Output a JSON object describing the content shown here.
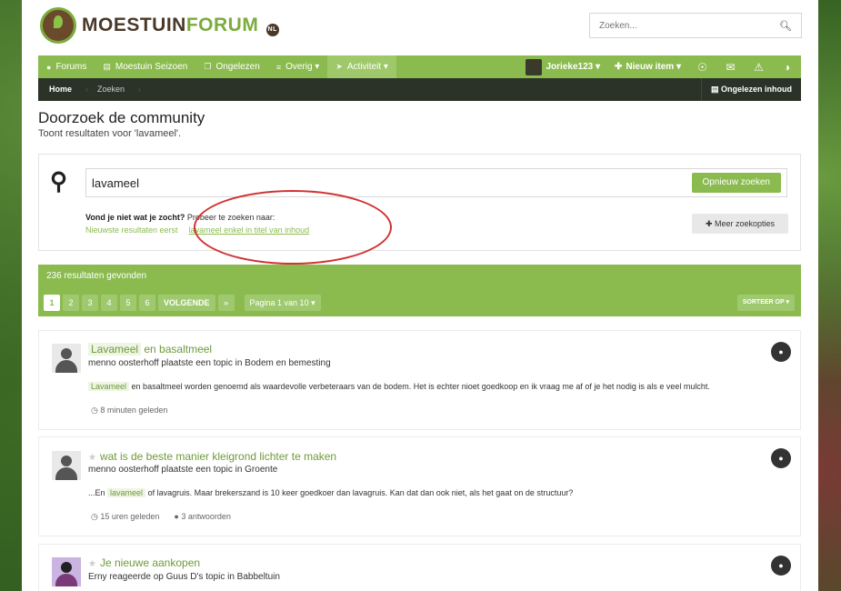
{
  "brand": {
    "part1": "MOESTUIN",
    "part2": "FORUM",
    "badge": "NL"
  },
  "header": {
    "search_placeholder": "Zoeken..."
  },
  "nav": {
    "items": [
      {
        "label": "Forums",
        "icon": "chat-bubbles-icon"
      },
      {
        "label": "Moestuin Seizoen",
        "icon": "book-icon"
      },
      {
        "label": "Ongelezen",
        "icon": "copy-icon"
      },
      {
        "label": "Overig ▾",
        "icon": "list-icon"
      },
      {
        "label": "Activiteit ▾",
        "icon": "megaphone-icon"
      }
    ],
    "user": "Jorieke123 ▾",
    "new_item": "Nieuw item ▾"
  },
  "breadcrumb": {
    "home": "Home",
    "current": "Zoeken",
    "unread": "Ongelezen inhoud"
  },
  "page": {
    "title": "Doorzoek de community",
    "subtitle": "Toont resultaten voor 'lavameel'."
  },
  "search": {
    "query": "lavameel",
    "button": "Opnieuw zoeken",
    "not_found_bold": "Vond je niet wat je zocht?",
    "not_found_rest": "Probeer te zoeken naar:",
    "suggestion1": "Nieuwste resultaten eerst",
    "suggestion2": "lavameel enkel in titel van inhoud",
    "more_options": "Meer zoekopties"
  },
  "results_bar": {
    "count": "236 resultaten gevonden",
    "pages": [
      "1",
      "2",
      "3",
      "4",
      "5",
      "6"
    ],
    "next": "VOLGENDE",
    "last": "»",
    "page_of": "Pagina 1 van 10 ▾",
    "sort": "SORTEER OP ▾"
  },
  "results": [
    {
      "title_hl": "Lavameel",
      "title_rest": "en basaltmeel",
      "meta": "menno oosterhoff plaatste een topic in Bodem en bemesting",
      "snippet_pre": "",
      "snippet_hl": "Lavameel",
      "snippet_post": "en basaltmeel worden genoemd als waardevolle verbeteraars van de bodem. Het is echter nioet goedkoop en ik vraag me af of je het nodig is als e veel mulcht.",
      "time": "8 minuten geleden",
      "replies": ""
    },
    {
      "title": "wat is de beste manier kleigrond lichter te maken",
      "meta": "menno oosterhoff plaatste een topic in Groente",
      "snippet_pre": "...En",
      "snippet_hl": "lavameel",
      "snippet_post": "of lavagruis. Maar brekerszand is 10 keer goedkoer dan lavagruis. Kan dat dan ook niet, als het gaat on de structuur?",
      "time": "15 uren geleden",
      "replies": "3 antwoorden"
    },
    {
      "title": "Je nieuwe aankopen",
      "meta": "Erny reageerde op Guus D's topic in Babbeltuin"
    }
  ]
}
